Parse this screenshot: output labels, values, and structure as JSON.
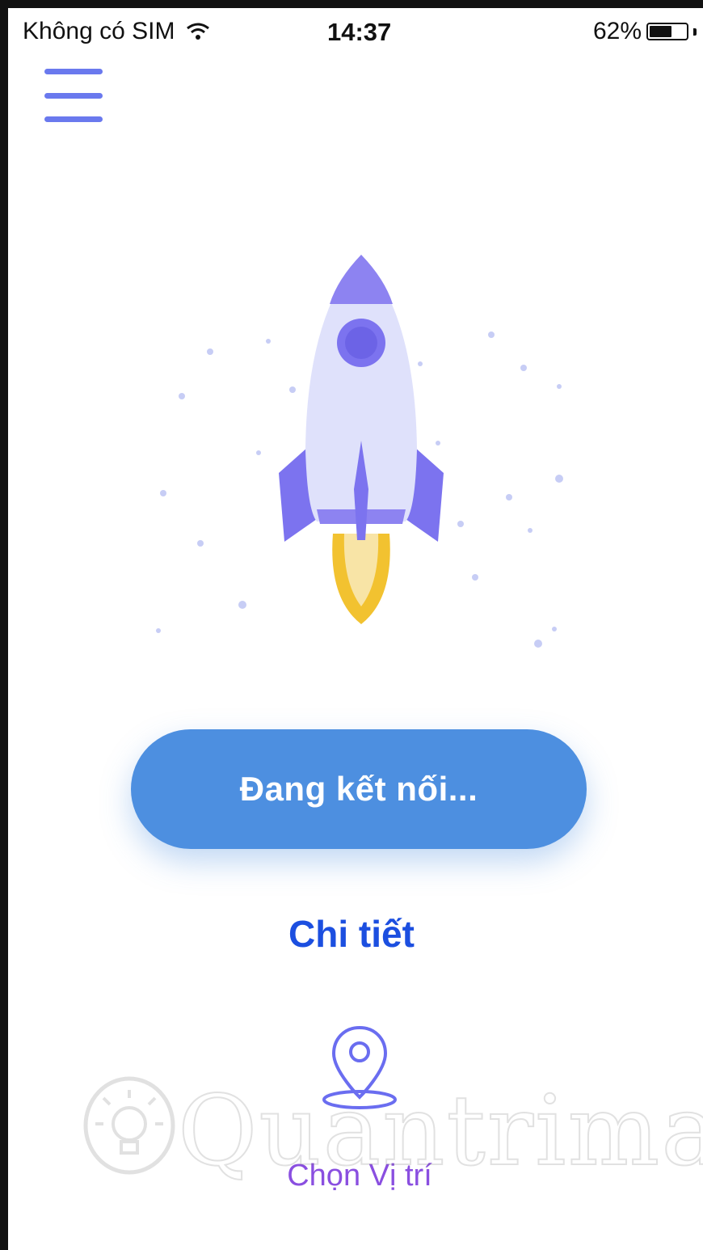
{
  "status_bar": {
    "carrier": "Không có SIM",
    "time": "14:37",
    "battery_percent": "62%",
    "battery_level": 0.62,
    "wifi_icon": "wifi-icon"
  },
  "header": {
    "menu_icon": "hamburger-menu-icon"
  },
  "hero": {
    "illustration": "rocket-illustration",
    "colors": {
      "rocket_body": "#dfe1fb",
      "rocket_accent": "#7c73ef",
      "flame": "#f2c230"
    }
  },
  "actions": {
    "connect_label": "Đang kết nối...",
    "details_label": "Chi tiết",
    "location_label": "Chọn Vị trí"
  },
  "watermark": {
    "text": "Quantrimang"
  },
  "colors": {
    "primary_button": "#4d8fe0",
    "link": "#1c4fe0",
    "location": "#8a4fe0",
    "menu": "#6a79ee"
  }
}
